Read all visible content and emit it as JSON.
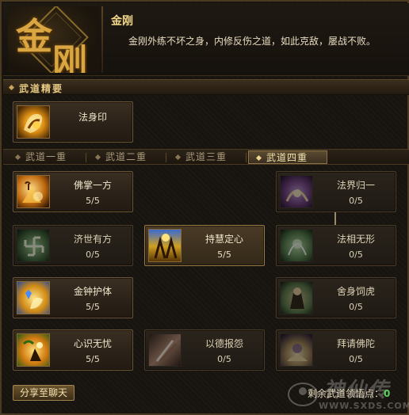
{
  "header": {
    "school_name": "金刚",
    "description": "金刚外练不坏之身，内修反伤之道，如此克敌，屡战不败。",
    "emblem_text": "金刚"
  },
  "essentials": {
    "title": "武道精要",
    "skill": {
      "name": "法身印",
      "icon": "dharma-seal-icon"
    }
  },
  "tabs": [
    {
      "label": "武道一重",
      "active": false
    },
    {
      "label": "武道二重",
      "active": false
    },
    {
      "label": "武道三重",
      "active": false
    },
    {
      "label": "武道四重",
      "active": true
    }
  ],
  "skills": [
    {
      "name": "佛掌一方",
      "level": "5/5",
      "icon": "buddha-palm-icon",
      "active": true
    },
    {
      "name": "法界归一",
      "level": "0/5",
      "icon": "dharma-realm-icon",
      "active": false
    },
    {
      "name": "济世有方",
      "level": "0/5",
      "icon": "swastika-icon",
      "active": false
    },
    {
      "name": "持慧定心",
      "level": "5/5",
      "icon": "wisdom-icon",
      "active": true
    },
    {
      "name": "法相无形",
      "level": "0/5",
      "icon": "formless-icon",
      "active": false
    },
    {
      "name": "金钟护体",
      "level": "5/5",
      "icon": "golden-bell-icon",
      "active": true
    },
    {
      "name": "舍身饲虎",
      "level": "0/5",
      "icon": "tiger-icon",
      "active": false
    },
    {
      "name": "心识无忧",
      "level": "5/5",
      "icon": "carefree-icon",
      "active": true
    },
    {
      "name": "以德报怨",
      "level": "0/5",
      "icon": "virtue-icon",
      "active": false
    },
    {
      "name": "拜请佛陀",
      "level": "0/5",
      "icon": "buddha-icon",
      "active": false
    }
  ],
  "footer": {
    "share_label": "分享至聊天",
    "points_label": "剩余武道领悟点：",
    "points_value": "0"
  },
  "watermark": {
    "text": "神仙传",
    "url": "WWW.SXDS.COM"
  },
  "colors": {
    "gold_text": "#f3d88a",
    "points_green": "#5ad05a",
    "border_gold": "#6b5534"
  }
}
